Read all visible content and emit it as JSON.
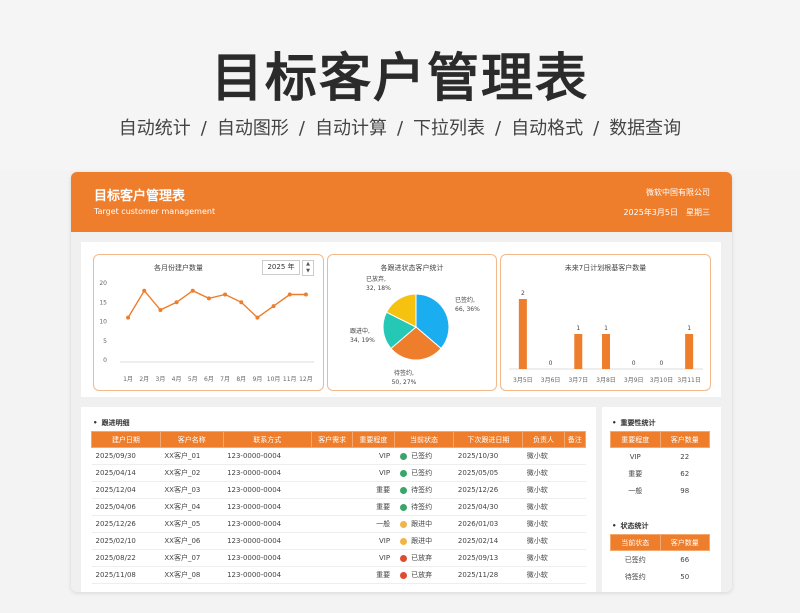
{
  "hero": {
    "title": "目标客户管理表",
    "features": [
      "自动统计",
      "自动图形",
      "自动计算",
      "下拉列表",
      "自动格式",
      "数据查询"
    ],
    "separator": "/"
  },
  "header": {
    "title": "目标客户管理表",
    "subtitle_en": "Target customer management",
    "company": "微软中国有限公司",
    "date": "2025年3月5日",
    "weekday": "星期三",
    "accent_color": "#ee7d2c"
  },
  "chart_data": [
    {
      "type": "line",
      "title": "各月份建户数量",
      "year_value": "2025 年",
      "categories": [
        "1月",
        "2月",
        "3月",
        "4月",
        "5月",
        "6月",
        "7月",
        "8月",
        "9月",
        "10月",
        "11月",
        "12月"
      ],
      "values": [
        11,
        18,
        13,
        15,
        18,
        16,
        17,
        15,
        11,
        14,
        17,
        17
      ],
      "ylim": [
        0,
        20
      ],
      "yticks": [
        0,
        5,
        10,
        15,
        20
      ],
      "color": "#ee7d2c"
    },
    {
      "type": "pie",
      "title": "各跟进状态客户统计",
      "slices": [
        {
          "name": "已签约",
          "value": 66,
          "label": "已签约,\n66, 36%",
          "color": "#1aaef0"
        },
        {
          "name": "待签约",
          "value": 50,
          "label": "待签约,\n50, 27%",
          "color": "#ee7d2c"
        },
        {
          "name": "跟进中",
          "value": 34,
          "label": "跟进中,\n34, 19%",
          "color": "#25c7b5"
        },
        {
          "name": "已放弃",
          "value": 32,
          "label": "已放弃,\n32, 18%",
          "color": "#f5c210"
        }
      ]
    },
    {
      "type": "bar",
      "title": "未来7日计划根基客户数量",
      "categories": [
        "3月5日",
        "3月6日",
        "3月7日",
        "3月8日",
        "3月9日",
        "3月10日",
        "3月11日"
      ],
      "values": [
        2,
        0,
        1,
        1,
        0,
        0,
        1
      ],
      "ylim": [
        0,
        2
      ],
      "color": "#ee7d2c"
    }
  ],
  "followup": {
    "section_title": "跟进明细",
    "columns": [
      "建户日期",
      "客户名称",
      "联系方式",
      "客户需求",
      "重要程度",
      "当前状态",
      "下次跟进日期",
      "负责人",
      "备注"
    ],
    "rows": [
      {
        "date": "2025/09/30",
        "name": "XX客户_01",
        "phone": "123-0000-0004",
        "need": "",
        "level": "VIP",
        "status": "已签约",
        "status_color": "#3aa56a",
        "next": "2025/10/30",
        "owner": "微小软",
        "note": ""
      },
      {
        "date": "2025/04/14",
        "name": "XX客户_02",
        "phone": "123-0000-0004",
        "need": "",
        "level": "VIP",
        "status": "已签约",
        "status_color": "#3aa56a",
        "next": "2025/05/05",
        "owner": "微小软",
        "note": ""
      },
      {
        "date": "2025/12/04",
        "name": "XX客户_03",
        "phone": "123-0000-0004",
        "need": "",
        "level": "重要",
        "status": "待签约",
        "status_color": "#3aa56a",
        "next": "2025/12/26",
        "owner": "微小软",
        "note": ""
      },
      {
        "date": "2025/04/06",
        "name": "XX客户_04",
        "phone": "123-0000-0004",
        "need": "",
        "level": "重要",
        "status": "待签约",
        "status_color": "#3aa56a",
        "next": "2025/04/30",
        "owner": "微小软",
        "note": ""
      },
      {
        "date": "2025/12/26",
        "name": "XX客户_05",
        "phone": "123-0000-0004",
        "need": "",
        "level": "一般",
        "status": "跟进中",
        "status_color": "#f0b44a",
        "next": "2026/01/03",
        "owner": "微小软",
        "note": ""
      },
      {
        "date": "2025/02/10",
        "name": "XX客户_06",
        "phone": "123-0000-0004",
        "need": "",
        "level": "VIP",
        "status": "跟进中",
        "status_color": "#f0b44a",
        "next": "2025/02/14",
        "owner": "微小软",
        "note": ""
      },
      {
        "date": "2025/08/22",
        "name": "XX客户_07",
        "phone": "123-0000-0004",
        "need": "",
        "level": "VIP",
        "status": "已放弃",
        "status_color": "#e04a2f",
        "next": "2025/09/13",
        "owner": "微小软",
        "note": ""
      },
      {
        "date": "2025/11/08",
        "name": "XX客户_08",
        "phone": "123-0000-0004",
        "need": "",
        "level": "重要",
        "status": "已放弃",
        "status_color": "#e04a2f",
        "next": "2025/11/28",
        "owner": "微小软",
        "note": ""
      }
    ]
  },
  "importance": {
    "section_title": "重要性统计",
    "columns": [
      "重要程度",
      "客户数量"
    ],
    "rows": [
      {
        "label": "VIP",
        "count": "22"
      },
      {
        "label": "重要",
        "count": "62"
      },
      {
        "label": "一般",
        "count": "98"
      }
    ]
  },
  "status_stats": {
    "section_title": "状态统计",
    "columns": [
      "当前状态",
      "客户数量"
    ],
    "rows": [
      {
        "label": "已签约",
        "count": "66"
      },
      {
        "label": "待签约",
        "count": "50"
      }
    ]
  }
}
